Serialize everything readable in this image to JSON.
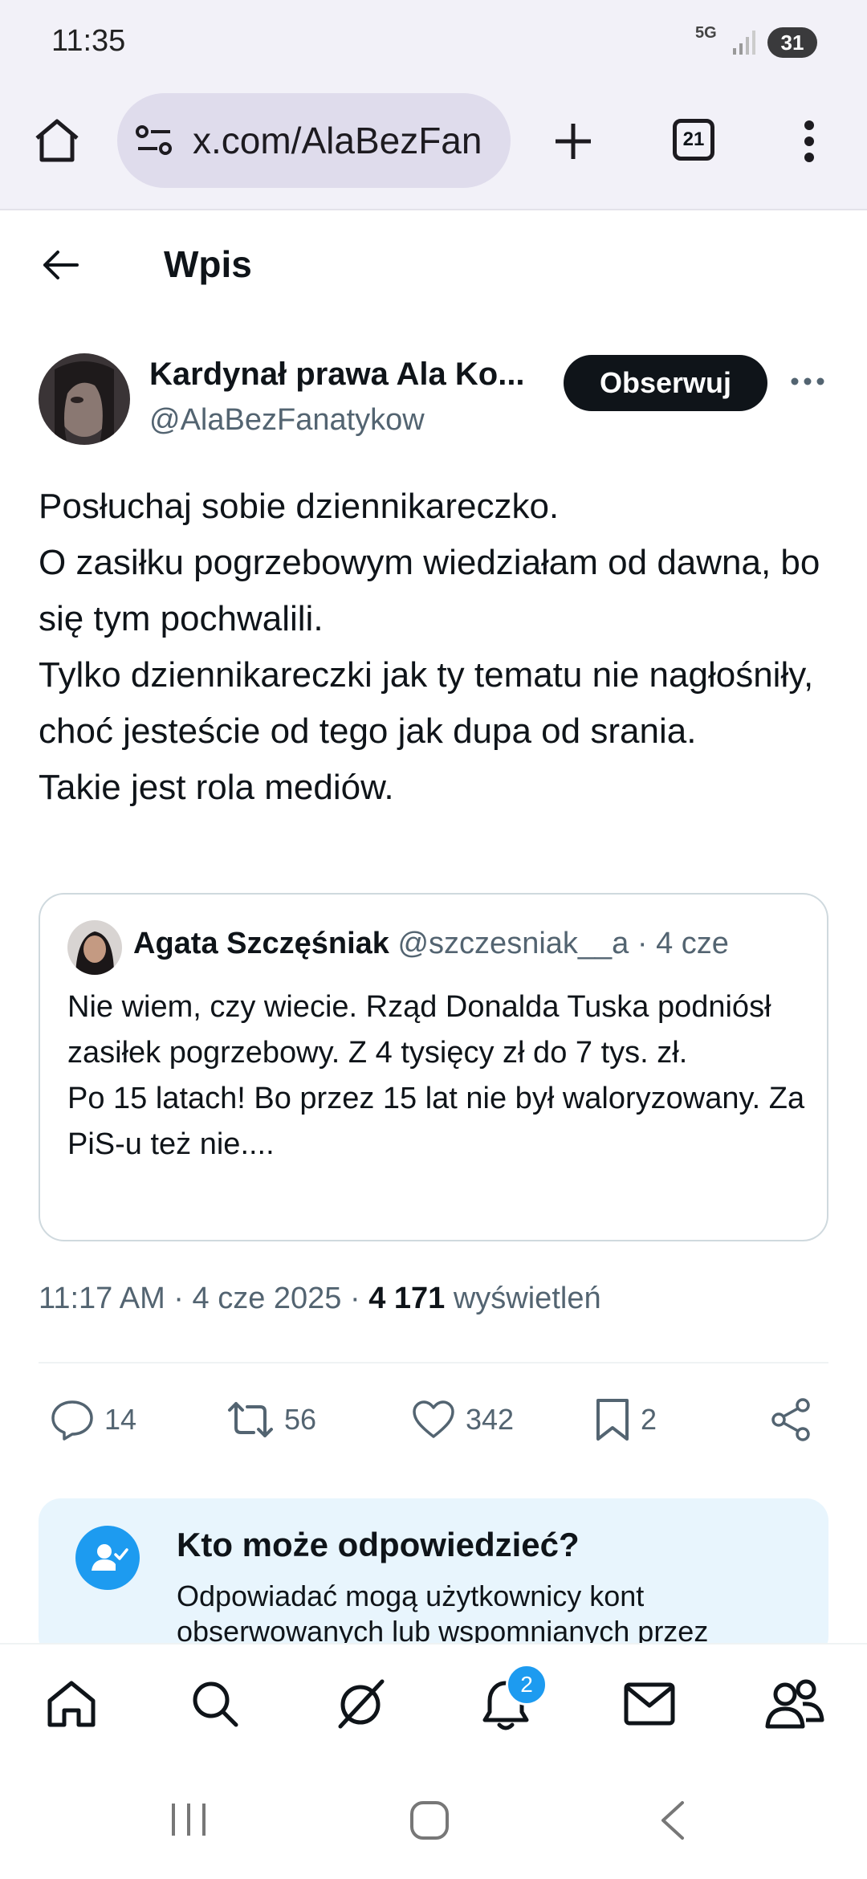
{
  "status_bar": {
    "time": "11:35",
    "network": "5G",
    "battery": "31"
  },
  "browser": {
    "url": "x.com/AlaBezFan",
    "tab_count": "21",
    "icons": [
      "home-icon",
      "site-settings-icon",
      "new-tab-icon",
      "tabs-icon",
      "more-vert-icon"
    ]
  },
  "header": {
    "title": "Wpis"
  },
  "post": {
    "author_name": "Kardynał prawa Ala Ko...",
    "author_handle": "@AlaBezFanatykow",
    "follow_label": "Obserwuj",
    "text": "Posłuchaj sobie dziennikareczko.\nO zasiłku pogrzebowym wiedziałam od dawna, bo się tym pochwalili.\nTylko dziennikareczki jak ty tematu nie nagłośniły, choć jesteście od tego jak dupa od srania.\nTakie jest rola mediów.",
    "quote": {
      "name": "Agata Szczęśniak",
      "handle_time": "@szczesniak__a · 4 cze",
      "text": "Nie wiem, czy wiecie. Rząd Donalda Tuska podniósł zasiłek pogrzebowy. Z 4 tysięcy zł do 7 tys. zł.\nPo 15 latach! Bo przez 15 lat nie był waloryzowany. Za PiS-u też nie...."
    },
    "timestamp": "11:17 AM · 4 cze 2025 · ",
    "views_count": "4 171",
    "views_label": " wyświetleń",
    "actions": {
      "replies": "14",
      "reposts": "56",
      "likes": "342",
      "bookmarks": "2"
    }
  },
  "reply_info": {
    "title": "Kto może odpowiedzieć?",
    "text": "Odpowiadać mogą użytkownicy kont obserwowanych lub wspomnianych przez"
  },
  "bottom_nav": {
    "notifications_badge": "2",
    "items": [
      "home-icon",
      "search-icon",
      "grok-icon",
      "notifications-icon",
      "messages-icon",
      "communities-icon"
    ]
  },
  "colors": {
    "accent": "#1d9bf0",
    "text": "#0f1419",
    "secondary": "#536471",
    "browser_bg": "#f2f1f8"
  }
}
